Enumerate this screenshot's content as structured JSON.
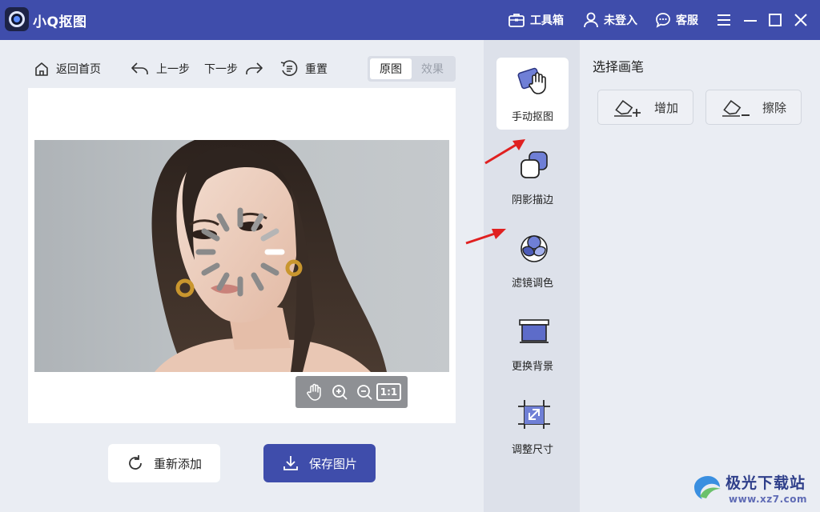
{
  "app": {
    "title": "小Q抠图"
  },
  "titlebar": {
    "toolbox_label": "工具箱",
    "login_label": "未登入",
    "service_label": "客服"
  },
  "toolbar": {
    "home_label": "返回首页",
    "undo_label": "上一步",
    "redo_label": "下一步",
    "reset_label": "重置",
    "view_original": "原图",
    "view_effect": "效果"
  },
  "zoom": {
    "reset_label": "1:1"
  },
  "actions": {
    "readd_label": "重新添加",
    "save_label": "保存图片"
  },
  "side": {
    "items": [
      {
        "label": "手动抠图",
        "icon": "hand-cutout-icon",
        "active": true
      },
      {
        "label": "阴影描边",
        "icon": "shadow-outline-icon",
        "active": false
      },
      {
        "label": "滤镜调色",
        "icon": "filter-color-icon",
        "active": false
      },
      {
        "label": "更换背景",
        "icon": "change-background-icon",
        "active": false
      },
      {
        "label": "调整尺寸",
        "icon": "resize-icon",
        "active": false
      }
    ]
  },
  "brush": {
    "title": "选择画笔",
    "add_label": "增加",
    "erase_label": "擦除"
  },
  "watermark": {
    "name": "极光下载站",
    "url": "www.xz7.com"
  },
  "colors": {
    "brand": "#3f4dab",
    "background": "#eaedf3",
    "panel": "#dde1ea",
    "arrow": "#e02020"
  }
}
